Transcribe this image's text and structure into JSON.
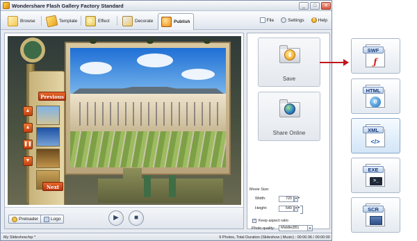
{
  "window": {
    "title": "Wondershare Flash Gallery Factory Standard",
    "controls": [
      "_",
      "□",
      "✕"
    ]
  },
  "tabs": [
    {
      "label": "Browse",
      "icon": "folder-icon"
    },
    {
      "label": "Template",
      "icon": "pencil-icon"
    },
    {
      "label": "Effect",
      "icon": "sparkle-icon"
    },
    {
      "label": "Decorate",
      "icon": "paint-icon"
    },
    {
      "label": "Publish",
      "icon": "publish-icon",
      "active": true
    }
  ],
  "menu": {
    "file": "File",
    "settings": "Settings",
    "help": "Help",
    "help_glyph": "?"
  },
  "preview": {
    "previous_label": "Previous",
    "next_label": "Next",
    "nav_glyphs": [
      "▲",
      "▲",
      "❚❚",
      "▼"
    ],
    "play_glyph": "▶",
    "stop_glyph": "■"
  },
  "controls": {
    "preloader_label": "Preloader",
    "logo_label": "Logo"
  },
  "output": {
    "save_label": "Save",
    "share_label": "Share Online",
    "save_glyph": "⬇"
  },
  "movie": {
    "title": "Movie Size:",
    "width_label": "Width:",
    "width_value": "720",
    "height_label": "Height:",
    "height_value": "540",
    "keep_aspect_label": "Keep aspect ratio",
    "keep_aspect_checked": true,
    "check_glyph": "✓",
    "quality_label": "Photo quality:",
    "quality_value": "Middle(85)",
    "spin_glyph": "▲▼",
    "dropdown_glyph": "▼"
  },
  "status": {
    "file": "My Slideshow.fsp *",
    "summary": "9 Photos, Total Duration (Slideshow | Music) : 00:00:36 / 00:00:00"
  },
  "formats": [
    {
      "label": "SWF",
      "icon": "flash-icon",
      "glyph": "ƒ"
    },
    {
      "label": "HTML",
      "icon": "browser-icon",
      "glyph": "e"
    },
    {
      "label": "XML",
      "icon": "xml-icon",
      "glyph": "</>",
      "selected": true
    },
    {
      "label": "EXE",
      "icon": "terminal-icon",
      "glyph": ">_"
    },
    {
      "label": "SCR",
      "icon": "monitor-icon",
      "glyph": ""
    }
  ],
  "colors": {
    "accent_arrow": "#c0141a",
    "window_bg": "#e7ebf1"
  }
}
